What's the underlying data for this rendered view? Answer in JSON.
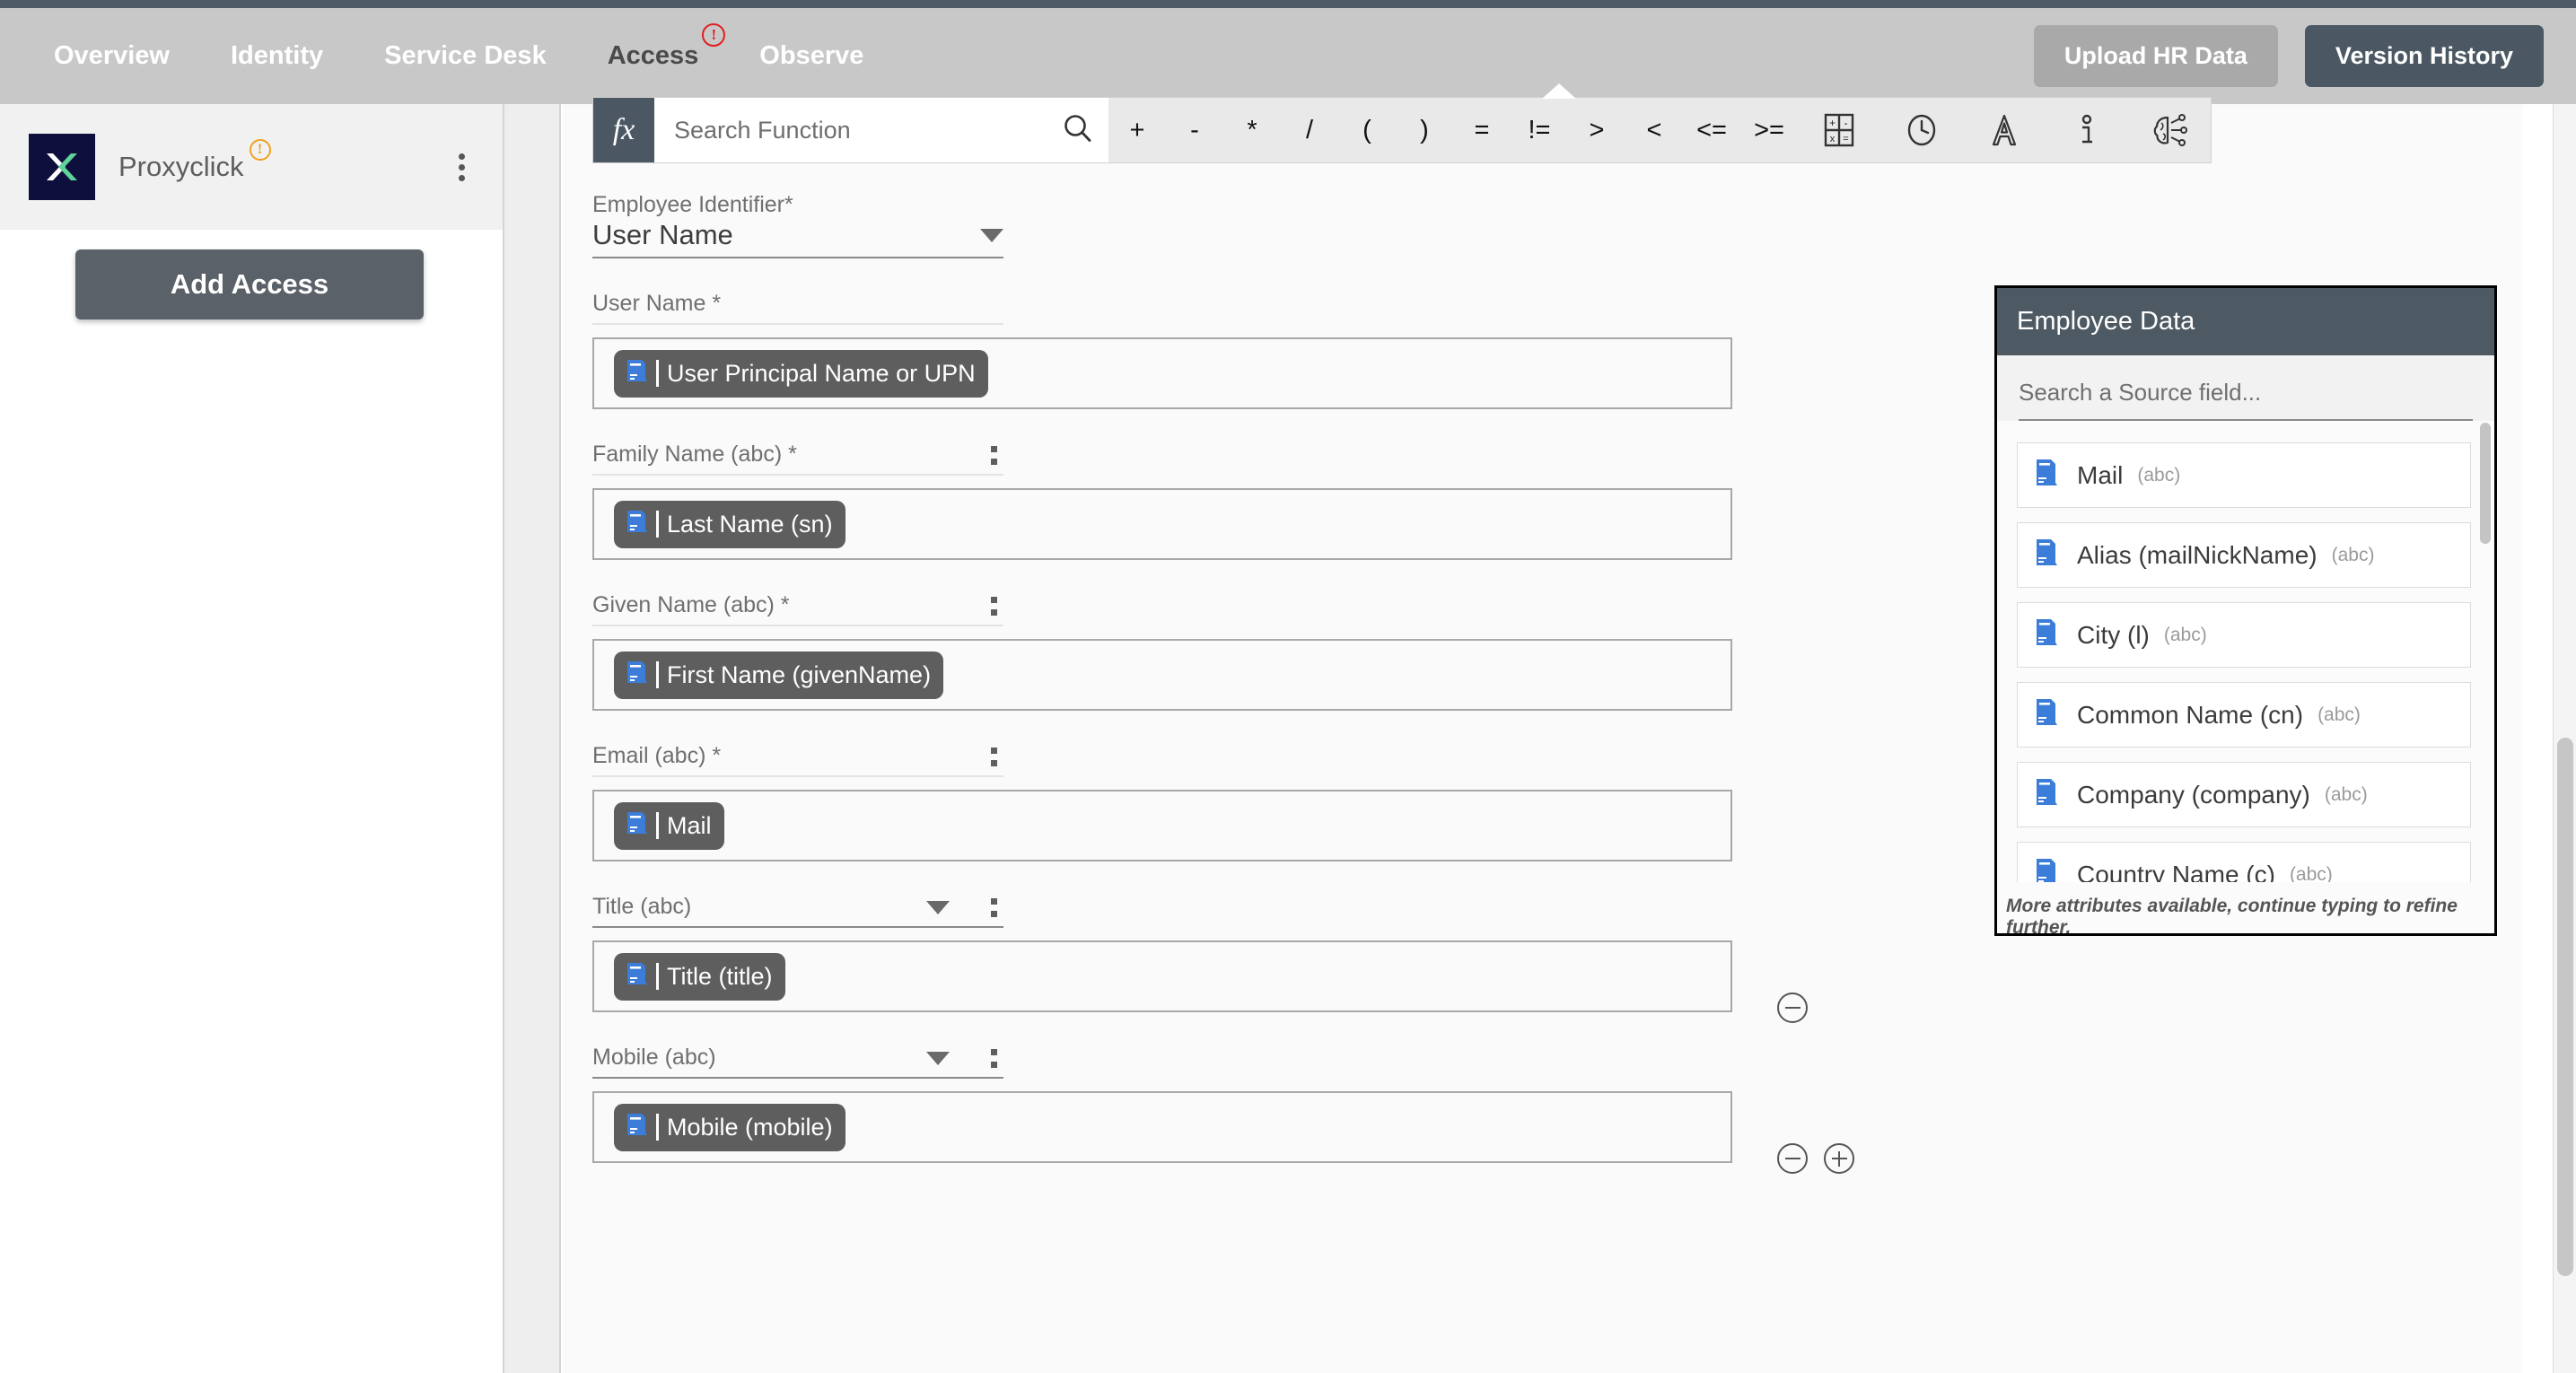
{
  "nav": {
    "items": [
      {
        "label": "Overview",
        "active": false,
        "badge": null
      },
      {
        "label": "Identity",
        "active": false,
        "badge": null
      },
      {
        "label": "Service Desk",
        "active": false,
        "badge": null
      },
      {
        "label": "Access",
        "active": true,
        "badge": "!"
      },
      {
        "label": "Observe",
        "active": false,
        "badge": null
      }
    ],
    "upload_button": "Upload HR Data",
    "version_button": "Version History"
  },
  "sidebar": {
    "app_name": "Proxyclick",
    "app_badge": "!",
    "add_access_button": "Add Access"
  },
  "toolbar": {
    "fx_label": "fx",
    "search_placeholder": "Search Function",
    "operators": [
      "+",
      "-",
      "*",
      "/",
      "(",
      ")",
      "=",
      "!=",
      ">",
      "<",
      "<=",
      ">="
    ],
    "icons": [
      "calculator-icon",
      "clock-icon",
      "text-icon",
      "info-icon",
      "ai-brain-icon"
    ]
  },
  "form": {
    "identifier": {
      "label": "Employee Identifier*",
      "value": "User Name"
    },
    "fields": [
      {
        "label": "User Name *",
        "chip": "User Principal Name or UPN",
        "has_caret": false,
        "has_kebab": false,
        "buttons": []
      },
      {
        "label": "Family Name (abc) *",
        "chip": "Last Name (sn)",
        "has_caret": false,
        "has_kebab": true,
        "buttons": []
      },
      {
        "label": "Given Name (abc) *",
        "chip": "First Name (givenName)",
        "has_caret": false,
        "has_kebab": true,
        "buttons": []
      },
      {
        "label": "Email (abc) *",
        "chip": "Mail",
        "has_caret": false,
        "has_kebab": true,
        "buttons": []
      },
      {
        "label": "Title (abc)",
        "chip": "Title (title)",
        "has_caret": true,
        "has_kebab": true,
        "buttons": [
          "minus"
        ]
      },
      {
        "label": "Mobile (abc)",
        "chip": "Mobile (mobile)",
        "has_caret": true,
        "has_kebab": true,
        "buttons": [
          "minus",
          "plus"
        ]
      }
    ]
  },
  "employee_panel": {
    "title": "Employee Data",
    "search_placeholder": "Search a Source field...",
    "items": [
      {
        "name": "Mail",
        "type": "(abc)"
      },
      {
        "name": "Alias (mailNickName)",
        "type": "(abc)"
      },
      {
        "name": "City (l)",
        "type": "(abc)"
      },
      {
        "name": "Common Name (cn)",
        "type": "(abc)"
      },
      {
        "name": "Company (company)",
        "type": "(abc)"
      },
      {
        "name": "Country Name (c)",
        "type": "(abc)"
      }
    ],
    "footer": "More attributes available, continue typing to refine further."
  },
  "colors": {
    "nav_bg": "#c8c8c8",
    "dark_slate": "#4b5863",
    "accent_blue": "#3b7dd8",
    "chip_bg": "#5e5e5e",
    "warn_orange": "#f0a020",
    "alert_red": "#e02020",
    "logo_navy": "#0e0f3d",
    "logo_green": "#5ed39a"
  }
}
